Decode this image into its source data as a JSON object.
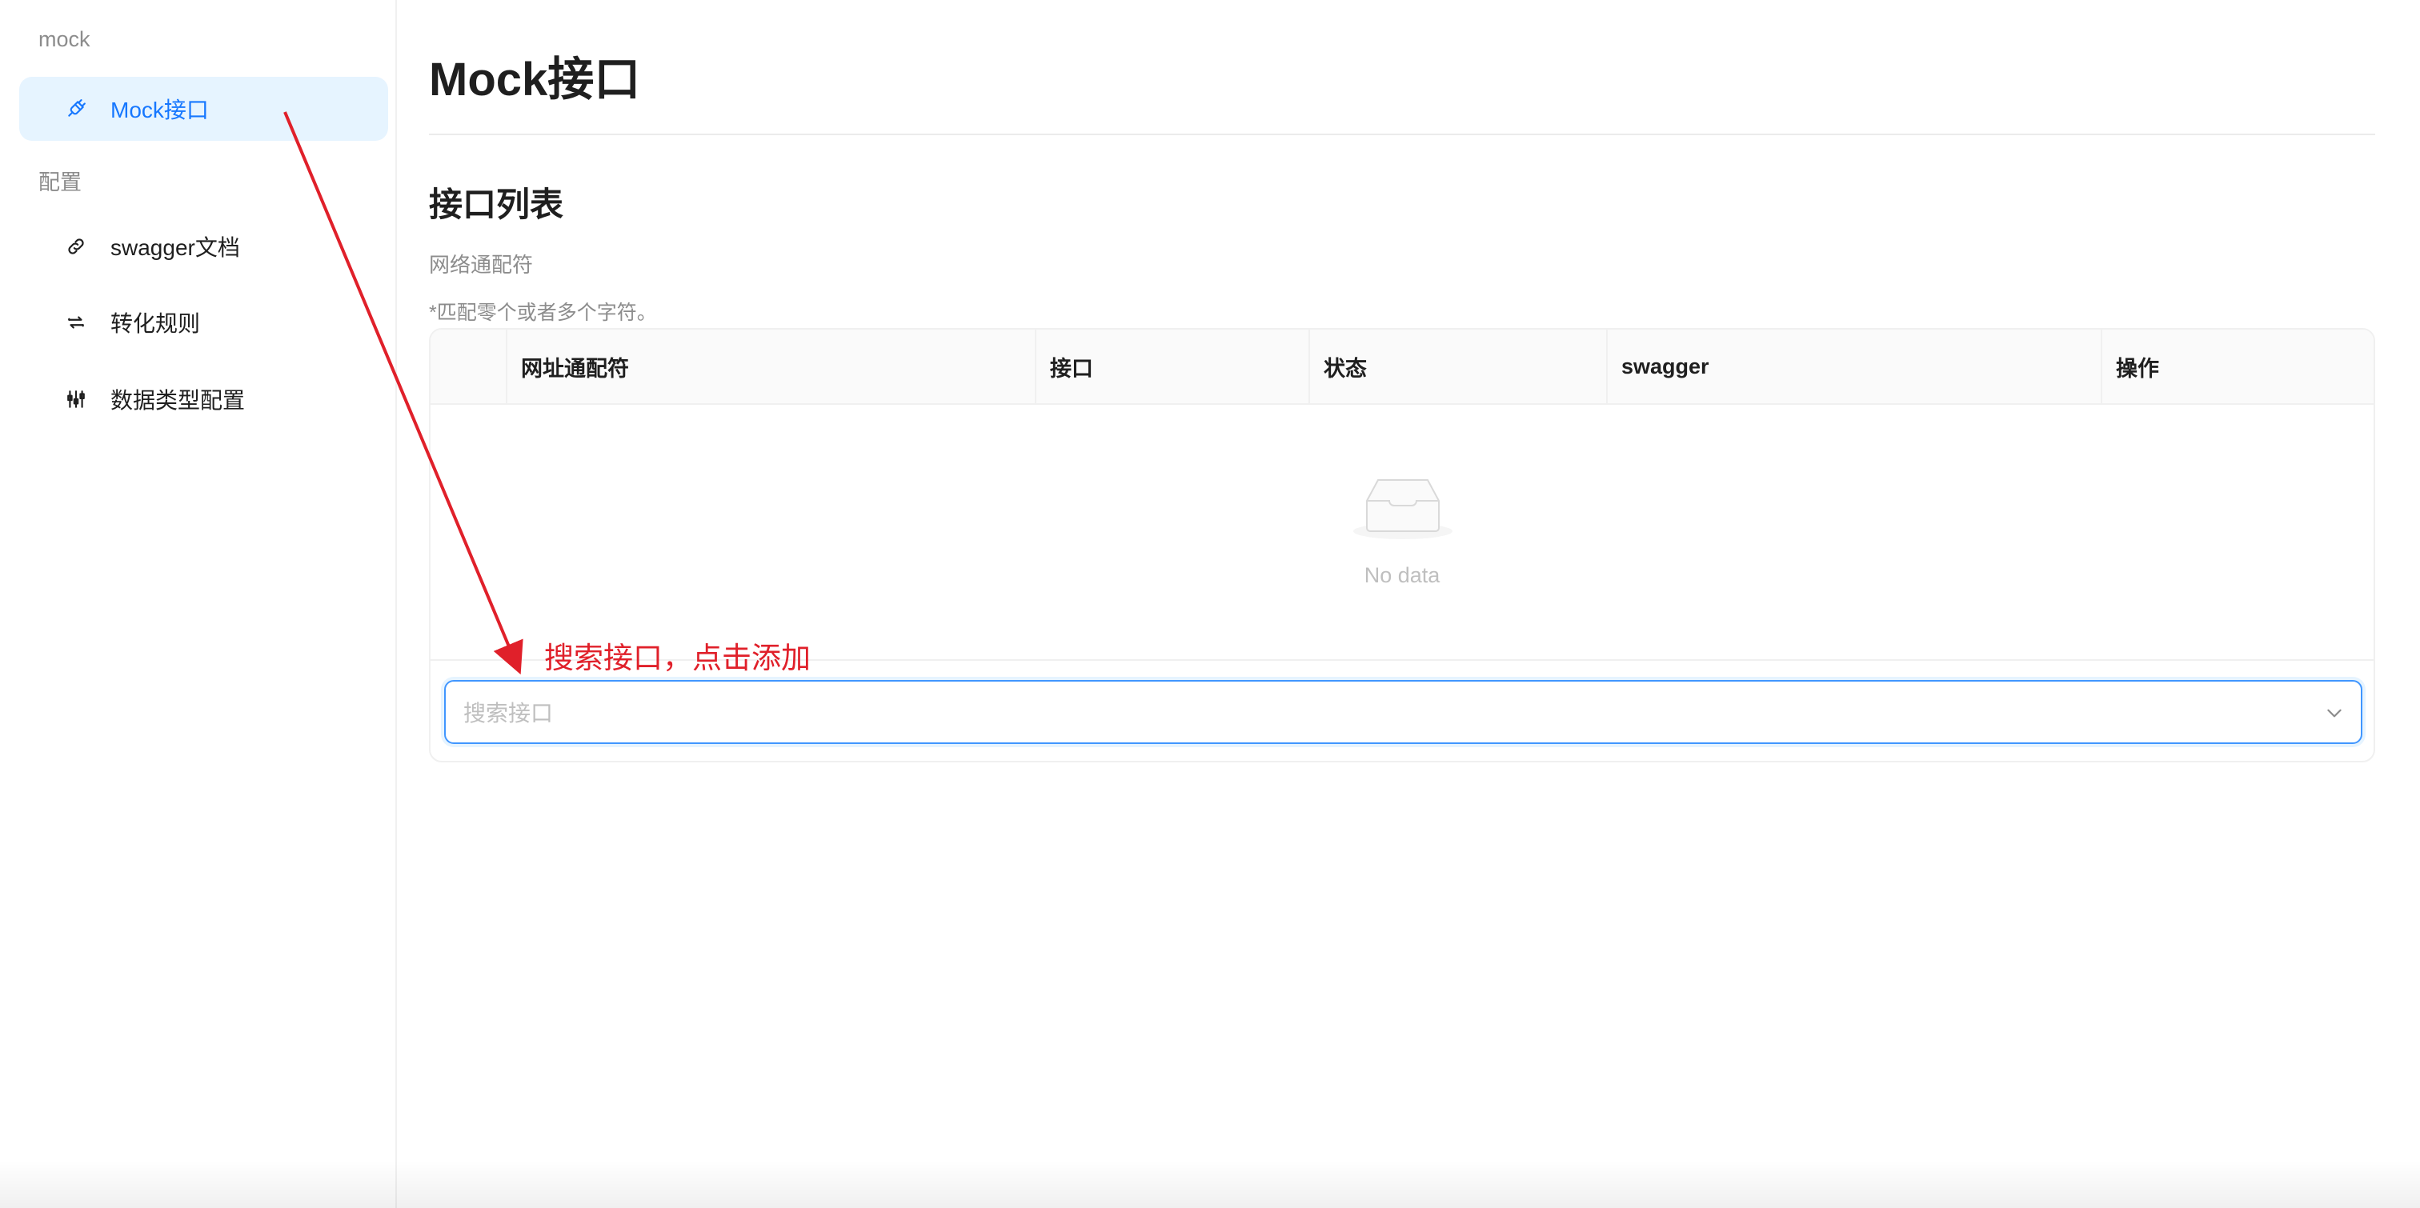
{
  "sidebar": {
    "groups": [
      {
        "title": "mock",
        "items": [
          {
            "label": "Mock接口",
            "icon": "api-icon",
            "active": true
          }
        ]
      },
      {
        "title": "配置",
        "items": [
          {
            "label": "swagger文档",
            "icon": "link-icon"
          },
          {
            "label": "转化规则",
            "icon": "swap-icon"
          },
          {
            "label": "数据类型配置",
            "icon": "sliders-icon"
          }
        ]
      }
    ]
  },
  "main": {
    "page_title": "Mock接口",
    "section_title": "接口列表",
    "field_label": "网络通配符",
    "hint": "*匹配零个或者多个字符。",
    "table": {
      "columns": [
        "网址通配符",
        "接口",
        "状态",
        "swagger",
        "操作"
      ],
      "rows": [],
      "empty_text": "No data"
    },
    "search_select": {
      "placeholder": "搜索接口",
      "icon": "chevron-down-icon"
    }
  },
  "annotation": {
    "text": "搜索接口，点击添加",
    "color": "#e0202a"
  },
  "colors": {
    "accent": "#1677ff",
    "active_bg": "#e6f4ff",
    "muted_text": "#8c8c8c"
  }
}
